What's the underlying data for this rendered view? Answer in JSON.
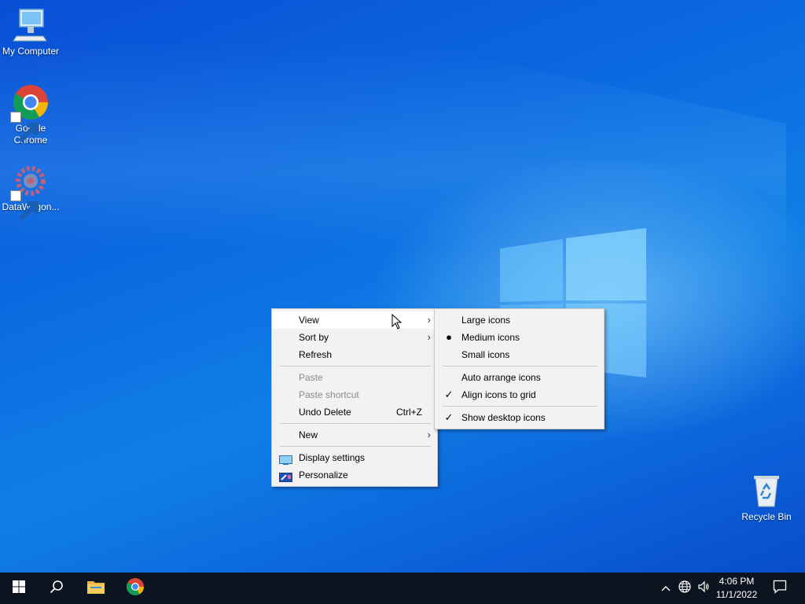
{
  "desktop": {
    "icons": [
      {
        "label": "My Computer",
        "icon": "computer-icon"
      },
      {
        "label": "Google Chrome",
        "icon": "chrome-icon"
      },
      {
        "label": "DataWagon...",
        "icon": "datawagon-icon"
      },
      {
        "label": "Recycle Bin",
        "icon": "recycle-bin-icon"
      }
    ]
  },
  "context_menu": {
    "items": {
      "view": "View",
      "sort_by": "Sort by",
      "refresh": "Refresh",
      "paste": "Paste",
      "paste_shortcut": "Paste shortcut",
      "undo_delete": "Undo Delete",
      "undo_delete_shortcut": "Ctrl+Z",
      "new": "New",
      "display_settings": "Display settings",
      "personalize": "Personalize"
    }
  },
  "view_submenu": {
    "large_icons": "Large icons",
    "medium_icons": "Medium icons",
    "small_icons": "Small icons",
    "auto_arrange": "Auto arrange icons",
    "align_to_grid": "Align icons to grid",
    "show_desktop_icons": "Show desktop icons",
    "selected_size": "Medium icons",
    "checked": [
      "Align icons to grid",
      "Show desktop icons"
    ]
  },
  "taskbar": {
    "time": "4:06 PM",
    "date": "11/1/2022",
    "pinned": [
      "start-icon",
      "search-icon",
      "file-explorer-icon",
      "chrome-icon"
    ],
    "tray": [
      "chevron-up-icon",
      "network-icon",
      "volume-icon",
      "notification-icon"
    ]
  },
  "colors": {
    "desktop_blue": "#0b6ae0",
    "taskbar": "#0c1420",
    "menu_bg": "#f2f2f2"
  }
}
